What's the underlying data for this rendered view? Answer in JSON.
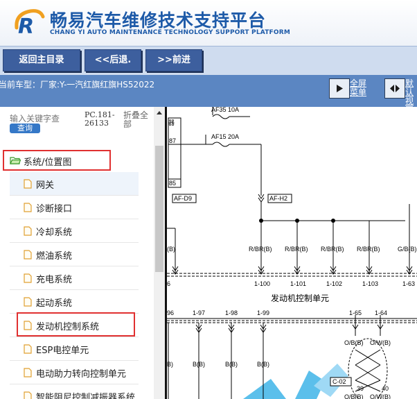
{
  "header": {
    "brand_cn": "畅易汽车维修技术支持平台",
    "brand_en": "CHANG YI AUTO MAINTENANCE TECHNOLOGY SUPPORT PLATFORM",
    "logo_icon": "ry-logo-icon"
  },
  "toolbar": {
    "home_label": "返回主目录",
    "back_label": "<<后退.",
    "forward_label": ">>前进"
  },
  "status": {
    "vehicle": "当前车型：厂家:Y-一汽红旗红旗HS52022",
    "fullscreen_l1": "全屏",
    "fullscreen_l2": "菜单",
    "default_l1": "默认",
    "default_l2": "视图"
  },
  "sidebar": {
    "search_placeholder": "输入关键字查",
    "search_button": "查询",
    "pc_code_l1": "PC.181-",
    "pc_code_l2": "26133",
    "collapse_l1": "折叠全",
    "collapse_l2": "部",
    "root_label": "系统/位置图",
    "items": [
      "网关",
      "诊断接口",
      "冷却系统",
      "燃油系统",
      "充电系统",
      "起动系统",
      "发动机控制系统",
      "ESP电控单元",
      "电动助力转向控制单元",
      "智能阻尼控制减振器系统"
    ]
  },
  "diagram": {
    "fuse_top": "AF35 10A",
    "fuse_mid": "AF15 20A",
    "label_qi": "器",
    "label_87": "87",
    "label_85": "85",
    "conn_afd9": "AF-D9",
    "conn_afh2": "AF-H2",
    "wire_b": "(B)",
    "wire_rbr1": "R/BR(B)",
    "wire_rbr2": "R/BR(B)",
    "wire_rbr3": "R/BR(B)",
    "wire_rbr4": "R/BR(B)",
    "wire_gbr": "G/B(B)",
    "pin_6": "6",
    "pin_1_100": "1-100",
    "pin_1_101": "1-101",
    "pin_1_102": "1-102",
    "pin_1_103": "1-103",
    "pin_1_63": "1-63",
    "ecu_label": "发动机控制单元",
    "pin_96": "96",
    "pin_1_97": "1-97",
    "pin_1_98": "1-98",
    "pin_1_99": "1-99",
    "pin_1_65": "1-65",
    "pin_1_64": "1-64",
    "wire_ob": "O/B(B)",
    "wire_ow": "O/W(B)",
    "wire_b2": "B)",
    "wire_b3": "B(B)",
    "wire_b4": "B(B)",
    "wire_b5": "B(B)",
    "conn_c02": "C-02",
    "pin_39": "39",
    "pin_40": "40",
    "wire_ob2": "O/B(B)",
    "wire_ow2": "O/W(B)"
  },
  "colors": {
    "brand": "#1d5aa8",
    "toolbar_button": "#3d5f9e",
    "status_bar": "#5b86c2",
    "highlight": "#e03030",
    "watermark": "#3fb5e8"
  }
}
